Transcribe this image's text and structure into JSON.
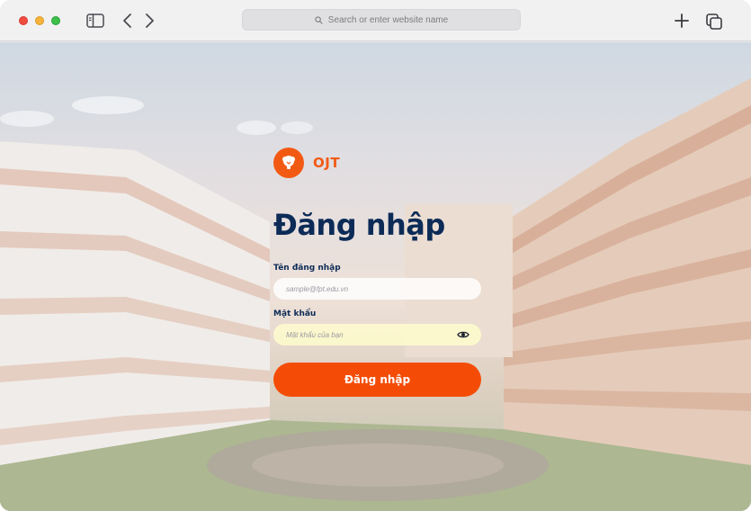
{
  "browser": {
    "address_placeholder": "Search or enter website name",
    "icons": [
      "sidebar-icon",
      "chevron-left-icon",
      "chevron-right-icon",
      "search-icon",
      "plus-icon",
      "tabs-overview-icon"
    ],
    "traffic_lights": [
      "#ee4c3f",
      "#f6b33a",
      "#3cc04a"
    ]
  },
  "brand": {
    "name": "OJT",
    "color": "#f25a14"
  },
  "login": {
    "title": "Đăng nhập",
    "username_label": "Tên đăng nhập",
    "username_placeholder": "sample@fpt.edu.vn",
    "password_label": "Mật khẩu",
    "password_placeholder": "Mật khẩu của bạn",
    "submit_label": "Đăng nhập",
    "accent_color": "#f44c06",
    "title_color": "#0c2b57"
  }
}
